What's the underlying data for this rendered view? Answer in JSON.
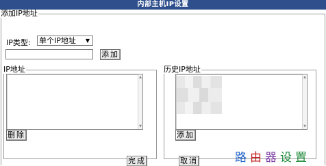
{
  "window": {
    "title": "内部主机IP设置"
  },
  "add_section": {
    "legend": "添加IP地址",
    "ip_type_label": "IP类型:",
    "ip_type_value": "单个IP地址",
    "ip_input_value": "",
    "add_button": "添加"
  },
  "ip_section": {
    "legend": "IP地址",
    "delete_button": "删除",
    "items": []
  },
  "history_section": {
    "legend": "历史IP地址",
    "add_button": "添加"
  },
  "footer": {
    "done_button": "完成",
    "cancel_button": "取消"
  },
  "watermark": [
    "路",
    "由",
    "器",
    "设置"
  ],
  "colors": {
    "titlebar": "#2e4f8c",
    "watermark": [
      "#1e63c7",
      "#c21f1f",
      "#7c3aa5",
      "#1f8a3b"
    ]
  }
}
